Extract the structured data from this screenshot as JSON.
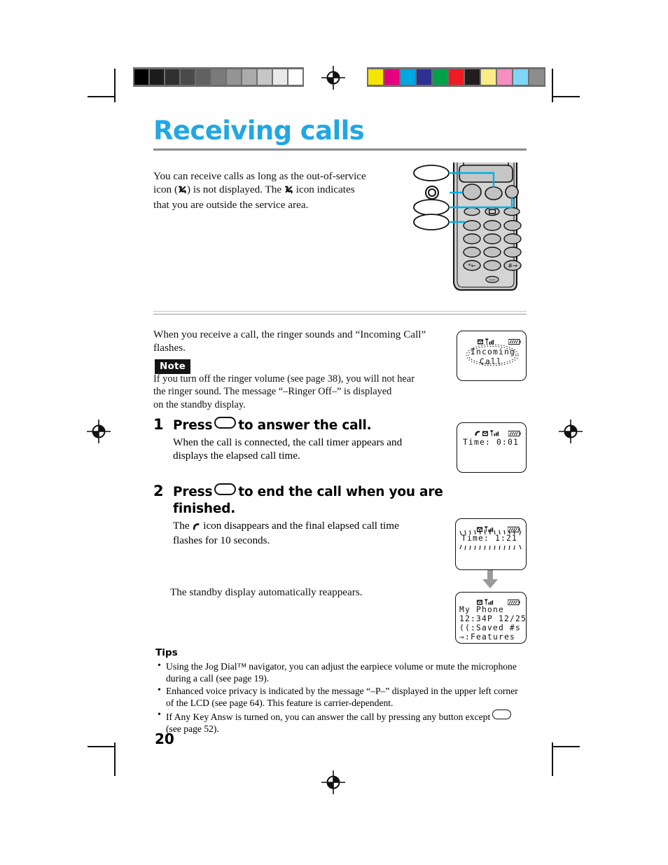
{
  "page": {
    "number": "20",
    "title": "Receiving calls"
  },
  "calibration": {
    "grayscale": [
      "#000000",
      "#1c1c1c",
      "#303030",
      "#4a4a4a",
      "#616161",
      "#7a7a7a",
      "#949494",
      "#ababab",
      "#c6c6c6",
      "#e9e9e9",
      "#ffffff"
    ],
    "colors": [
      "#f5e400",
      "#e5007e",
      "#00a7e1",
      "#2e3192",
      "#00a14b",
      "#ed1c24",
      "#211d1e",
      "#fbec83",
      "#f48fc0",
      "#7fd6f7",
      "#8d8d8d"
    ]
  },
  "intro": {
    "line1": "You can receive calls as long as the out-of-service",
    "line2_pre": "icon (",
    "line2_mid": ") is not displayed. The ",
    "line2_post": " icon indicates",
    "line3": "that you are outside the service area."
  },
  "ringer": {
    "line1": "When you receive a call, the ringer sounds and “Incoming Call”",
    "line2": "flashes."
  },
  "note": {
    "label": "Note",
    "line1": "If you turn off the ringer volume (see page 38), you will not hear",
    "line2": "the ringer sound. The message “–Ringer Off–” is displayed",
    "line3": "on the standby display."
  },
  "steps": [
    {
      "number": "1",
      "head_pre": "Press",
      "head_post": "to answer the call.",
      "desc_line1": "When the call is connected, the call timer appears and",
      "desc_line2": "displays the elapsed call time."
    },
    {
      "number": "2",
      "head_pre": "Press",
      "head_post": "to end the call when you are",
      "head_line2": "finished.",
      "desc_pre": "The",
      "desc_post": "icon disappears and the final elapsed call time",
      "desc_line2": "flashes for 10 seconds."
    }
  ],
  "standby_note": "The standby display automatically reappears.",
  "tips": {
    "heading": "Tips",
    "items": [
      {
        "line1": "Using the Jog Dial™ navigator, you can adjust the earpiece volume or mute the microphone",
        "line2": "during a call (see page 19)."
      },
      {
        "line1": "Enhanced voice privacy is indicated by the message “–P–” displayed in the upper left corner",
        "line2": "of the LCD (see page 64). This feature is carrier-dependent."
      },
      {
        "line1_pre": "If Any Key Answ is turned on, you can answer the call by pressing any button except",
        "line2": "(see page 52)."
      }
    ]
  },
  "displays": {
    "incoming": {
      "line1": "Incoming",
      "line2": "Call",
      "flashing": true
    },
    "timer_start": {
      "label": "Time:",
      "value": "0:01",
      "has_handset_icon": true
    },
    "timer_end": {
      "label": "Time:",
      "value": "1:21",
      "flashing": true
    },
    "standby": {
      "line1": "My Phone",
      "line2": "12:34P 12/25",
      "line3_icon": "((",
      "line3": ":Saved #s",
      "line4_icon": "⇒",
      "line4": ":Features"
    }
  },
  "colors": {
    "title": "#22a7e2",
    "callout_line": "#00b0e6",
    "rule": "#8a8a8a",
    "phone_body": "#c8c8c8",
    "arrow": "#9a9a9a"
  }
}
